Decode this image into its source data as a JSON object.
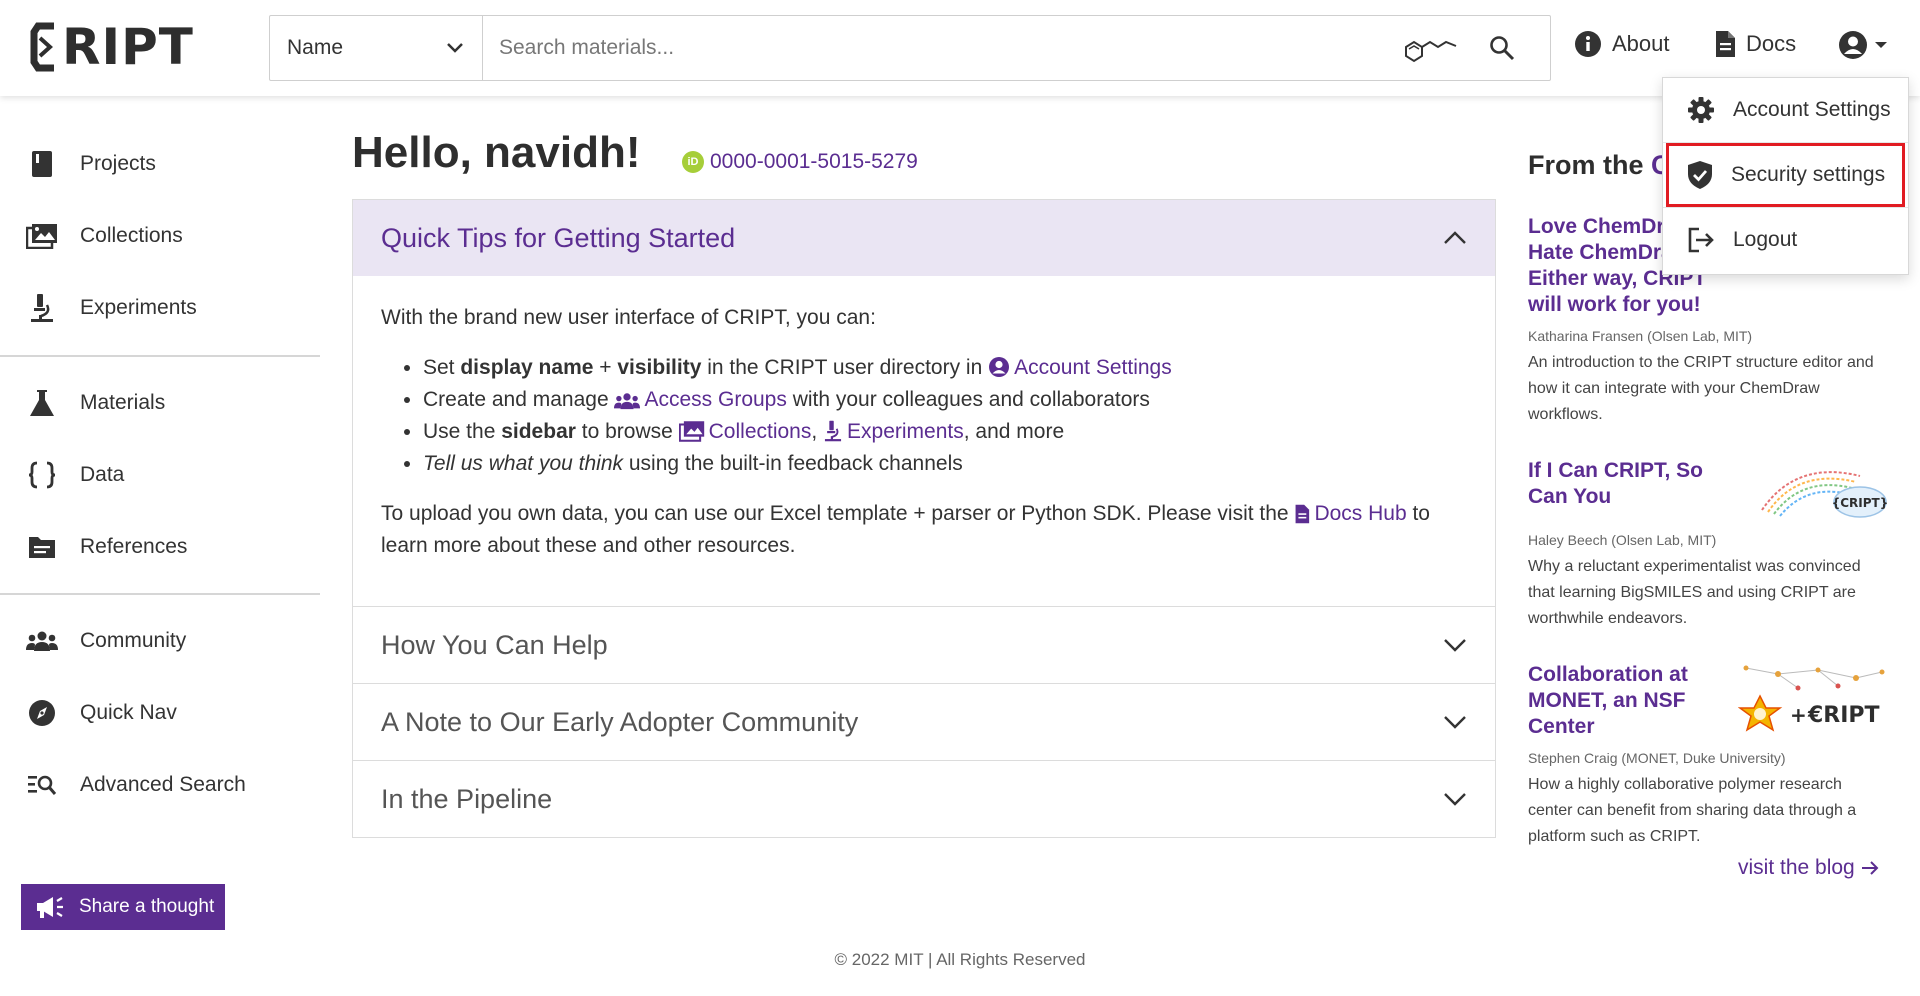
{
  "header": {
    "logo_text": "RIPT",
    "search_type": "Name",
    "search_placeholder": "Search materials...",
    "about_label": "About",
    "docs_label": "Docs"
  },
  "account_menu": {
    "items": [
      {
        "label": "Account Settings",
        "icon": "gear-icon"
      },
      {
        "label": "Security settings",
        "icon": "shield-check-icon",
        "highlighted": true
      },
      {
        "label": "Logout",
        "icon": "logout-icon"
      }
    ]
  },
  "sidebar": {
    "items": [
      {
        "label": "Projects",
        "icon": "book-icon"
      },
      {
        "label": "Collections",
        "icon": "images-icon"
      },
      {
        "label": "Experiments",
        "icon": "microscope-icon"
      },
      {
        "label": "Materials",
        "icon": "flask-icon"
      },
      {
        "label": "Data",
        "icon": "braces-icon"
      },
      {
        "label": "References",
        "icon": "folder-icon"
      },
      {
        "label": "Community",
        "icon": "users-icon"
      },
      {
        "label": "Quick Nav",
        "icon": "compass-icon"
      },
      {
        "label": "Advanced Search",
        "icon": "search-list-icon"
      }
    ],
    "share_label": "Share a thought"
  },
  "main": {
    "greeting": "Hello, navidh!",
    "orcid": "0000-0001-5015-5279",
    "accordion": [
      {
        "title": "Quick Tips for Getting Started",
        "open": true
      },
      {
        "title": "How You Can Help",
        "open": false
      },
      {
        "title": "A Note to Our Early Adopter Community",
        "open": false
      },
      {
        "title": "In the Pipeline",
        "open": false
      }
    ],
    "tips": {
      "intro": "With the brand new user interface of CRIPT, you can:",
      "b1_pre": "Set ",
      "b1_bold1": "display name",
      "b1_plus": " + ",
      "b1_bold2": "visibility",
      "b1_mid": " in the CRIPT user directory in ",
      "b1_link": "Account Settings",
      "b2_pre": "Create and manage ",
      "b2_link": "Access Groups",
      "b2_post": " with your colleagues and collaborators",
      "b3_pre": "Use the ",
      "b3_bold": "sidebar",
      "b3_mid": " to browse ",
      "b3_link1": "Collections",
      "b3_comma": ", ",
      "b3_link2": "Experiments",
      "b3_post": ", and more",
      "b4_italic": "Tell us what you think",
      "b4_post": " using the built-in feedback channels",
      "upload_pre": "To upload you own data, you can use our Excel template + parser or Python SDK. Please visit the ",
      "upload_link": "Docs Hub",
      "upload_post": " to learn more about these and other resources."
    }
  },
  "blog": {
    "heading_pre": "From the ",
    "heading_accent": "C",
    "posts": [
      {
        "title": "Love ChemDraw? Hate ChemDraw? Either way, CRIPT will work for you!",
        "author": "Katharina Fransen (Olsen Lab, MIT)",
        "desc": "An introduction to the CRIPT structure editor and how it can integrate with your ChemDraw workflows."
      },
      {
        "title": "If I Can CRIPT, So Can You",
        "author": "Haley Beech (Olsen Lab, MIT)",
        "desc": "Why a reluctant experimentalist was convinced that learning BigSMILES and using CRIPT are worthwhile endeavors."
      },
      {
        "title": "Collaboration at MONET, an NSF Center",
        "author": "Stephen Craig (MONET, Duke University)",
        "desc": "How a highly collaborative polymer research center can benefit from sharing data through a platform such as CRIPT."
      }
    ],
    "visit_label": "visit the blog"
  },
  "footer": {
    "text": "© 2022 MIT | All Rights Reserved"
  },
  "colors": {
    "brand": "#5b2d91",
    "accordion_open_bg": "#eae5f3",
    "highlight_border": "#e11b22",
    "orcid_green": "#a6ce39"
  }
}
